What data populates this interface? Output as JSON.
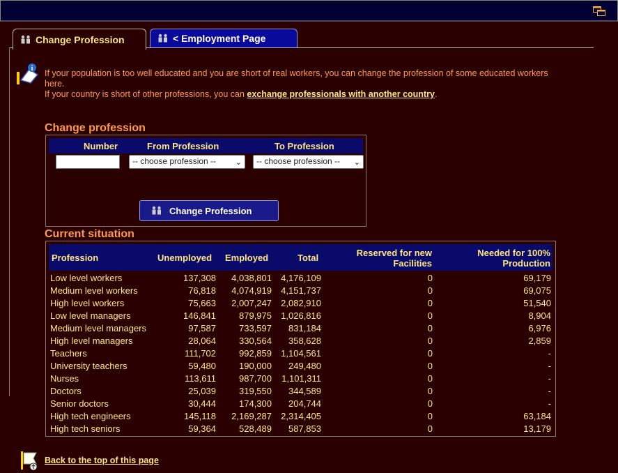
{
  "tabs": [
    {
      "label": "Change Profession"
    },
    {
      "label": "< Employment Page"
    }
  ],
  "intro": {
    "line1": "If your population is too well educated and you are short of real workers, you can change the profession of some educated workers here.",
    "line2_prefix": "If your country is short of other professions, you can ",
    "line2_link": "exchange professionals with another country",
    "line2_suffix": "."
  },
  "change_section": {
    "title": "Change profession",
    "col_number": "Number",
    "col_from": "From Profession",
    "col_to": "To Profession",
    "number_value": "",
    "from_selected": "-- choose profession --",
    "to_selected": "-- choose profession --",
    "submit_label": "Change Profession"
  },
  "situation": {
    "title": "Current situation",
    "headers": {
      "profession": "Profession",
      "unemployed": "Unemployed",
      "employed": "Employed",
      "total": "Total",
      "reserved_1": "Reserved for new",
      "reserved_2": "Facilities",
      "needed_1": "Needed for 100%",
      "needed_2": "Production"
    },
    "rows": [
      {
        "profession": "Low level workers",
        "unemployed": "137,308",
        "employed": "4,038,801",
        "total": "4,176,109",
        "reserved": "0",
        "needed": "69,179"
      },
      {
        "profession": "Medium level workers",
        "unemployed": "76,818",
        "employed": "4,074,919",
        "total": "4,151,737",
        "reserved": "0",
        "needed": "69,075"
      },
      {
        "profession": "High level workers",
        "unemployed": "75,663",
        "employed": "2,007,247",
        "total": "2,082,910",
        "reserved": "0",
        "needed": "51,540"
      },
      {
        "profession": "Low level managers",
        "unemployed": "146,841",
        "employed": "879,975",
        "total": "1,026,816",
        "reserved": "0",
        "needed": "8,904"
      },
      {
        "profession": "Medium level managers",
        "unemployed": "97,587",
        "employed": "733,597",
        "total": "831,184",
        "reserved": "0",
        "needed": "6,976"
      },
      {
        "profession": "High level managers",
        "unemployed": "28,064",
        "employed": "330,564",
        "total": "358,628",
        "reserved": "0",
        "needed": "2,859"
      },
      {
        "profession": "Teachers",
        "unemployed": "111,702",
        "employed": "992,859",
        "total": "1,104,561",
        "reserved": "0",
        "needed": "-"
      },
      {
        "profession": "University teachers",
        "unemployed": "59,480",
        "employed": "190,000",
        "total": "249,480",
        "reserved": "0",
        "needed": "-"
      },
      {
        "profession": "Nurses",
        "unemployed": "113,611",
        "employed": "987,700",
        "total": "1,101,311",
        "reserved": "0",
        "needed": "-"
      },
      {
        "profession": "Doctors",
        "unemployed": "25,039",
        "employed": "319,550",
        "total": "344,589",
        "reserved": "0",
        "needed": "-"
      },
      {
        "profession": "Senior doctors",
        "unemployed": "30,444",
        "employed": "174,300",
        "total": "204,744",
        "reserved": "0",
        "needed": "-"
      },
      {
        "profession": "High tech engineers",
        "unemployed": "145,118",
        "employed": "2,169,287",
        "total": "2,314,405",
        "reserved": "0",
        "needed": "63,184"
      },
      {
        "profession": "High tech seniors",
        "unemployed": "59,364",
        "employed": "528,489",
        "total": "587,853",
        "reserved": "0",
        "needed": "13,179"
      }
    ]
  },
  "footer": {
    "back_link": "Back to the top of this page"
  },
  "colors": {
    "background": "#2b0000",
    "header_blue": "#0a0a6a",
    "text_yellow": "#ffe680",
    "text_orange": "#ff9a4a"
  }
}
